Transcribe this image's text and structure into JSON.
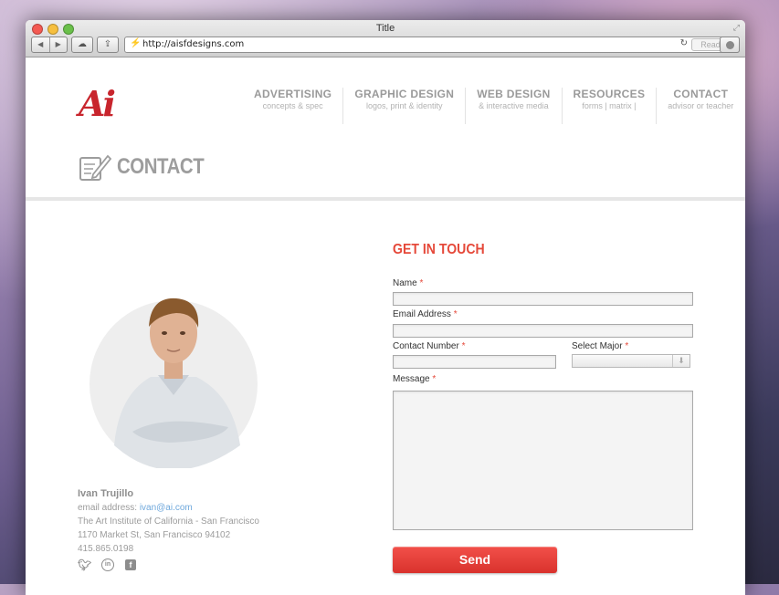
{
  "window": {
    "title": "Title",
    "url": "http://aisfdesigns.com",
    "reader_label": "Reader"
  },
  "site": {
    "logo_text": "Ai",
    "nav": [
      {
        "label": "ADVERTISING",
        "sub": "concepts & spec"
      },
      {
        "label": "GRAPHIC DESIGN",
        "sub": "logos, print & identity"
      },
      {
        "label": "WEB DESIGN",
        "sub": "& interactive media"
      },
      {
        "label": "RESOURCES",
        "sub": "forms | matrix |"
      },
      {
        "label": "CONTACT",
        "sub": "advisor or teacher"
      }
    ],
    "page_heading": "CONTACT"
  },
  "contact": {
    "name": "Ivan Trujillo",
    "email_label": "email address: ",
    "email": "ivan@ai.com",
    "school": "The Art Institute of California - San Francisco",
    "address": "1170 Market St, San Francisco 94102",
    "phone": "415.865.0198",
    "social_icons": [
      "twitter-icon",
      "linkedin-icon",
      "facebook-icon"
    ]
  },
  "form": {
    "title": "GET IN TOUCH",
    "required_mark": "*",
    "name_label": "Name",
    "email_label": "Email Address",
    "phone_label": "Contact Number",
    "major_label": "Select Major",
    "message_label": "Message",
    "send_label": "Send"
  },
  "colors": {
    "accent": "#e5493a",
    "brand_red": "#c8252d",
    "link": "#6fa8dc"
  }
}
